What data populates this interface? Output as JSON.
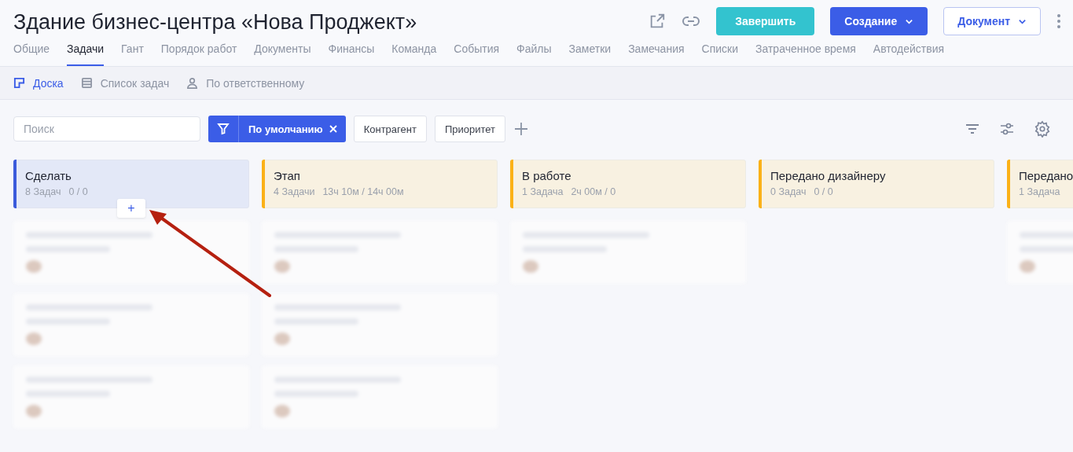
{
  "title": "Здание бизнес-центра «Нова Проджект»",
  "header_buttons": [
    {
      "label": "Завершить",
      "kind": "teal"
    },
    {
      "label": "Создание",
      "kind": "primary"
    },
    {
      "label": "Документ",
      "kind": "outline"
    }
  ],
  "tabs": [
    {
      "label": "Общие",
      "selected": false
    },
    {
      "label": "Задачи",
      "selected": true
    },
    {
      "label": "Гант",
      "selected": false
    },
    {
      "label": "Порядок работ",
      "selected": false
    },
    {
      "label": "Документы",
      "selected": false
    },
    {
      "label": "Финансы",
      "selected": false
    },
    {
      "label": "Команда",
      "selected": false
    },
    {
      "label": "События",
      "selected": false
    },
    {
      "label": "Файлы",
      "selected": false
    },
    {
      "label": "Заметки",
      "selected": false
    },
    {
      "label": "Замечания",
      "selected": false
    },
    {
      "label": "Списки",
      "selected": false
    },
    {
      "label": "Затраченное время",
      "selected": false
    },
    {
      "label": "Автодействия",
      "selected": false
    }
  ],
  "views": [
    {
      "label": "Доска",
      "kind": "board",
      "selected": true
    },
    {
      "label": "Список задач",
      "kind": "list",
      "selected": false
    },
    {
      "label": "По ответственному",
      "kind": "person",
      "selected": false
    }
  ],
  "search": {
    "placeholder": "Поиск"
  },
  "filter_chip": {
    "label": "По умолчанию"
  },
  "filters": [
    "Контрагент",
    "Приоритет"
  ],
  "columns": [
    {
      "name": "Сделать",
      "stats": "8 Задач",
      "time": "0 / 0",
      "color": "#3b5bdb",
      "selected": true,
      "cards": [
        {
          "kind": "blurred"
        },
        {
          "kind": "blurred"
        },
        {
          "kind": "blurred"
        }
      ]
    },
    {
      "name": "Этап",
      "stats": "4 Задачи",
      "time": "13ч 10м / 14ч 00м",
      "color": "#fbb117",
      "selected": false,
      "cards": [
        {
          "kind": "blurred"
        },
        {
          "kind": "blurred"
        },
        {
          "kind": "blurred"
        }
      ]
    },
    {
      "name": "В работе",
      "stats": "1 Задача",
      "time": "2ч 00м / 0",
      "color": "#fbb117",
      "selected": false,
      "cards": [
        {
          "kind": "blurred"
        }
      ]
    },
    {
      "name": "Передано дизайнеру",
      "stats": "0 Задач",
      "time": "0 / 0",
      "color": "#fbb117",
      "selected": false
    },
    {
      "name": "Передано",
      "stats": "1 Задача",
      "color": "#fbb117",
      "selected": false,
      "cards": [
        {
          "kind": "blurred"
        }
      ]
    }
  ],
  "add_task_button": {
    "label": "+"
  }
}
